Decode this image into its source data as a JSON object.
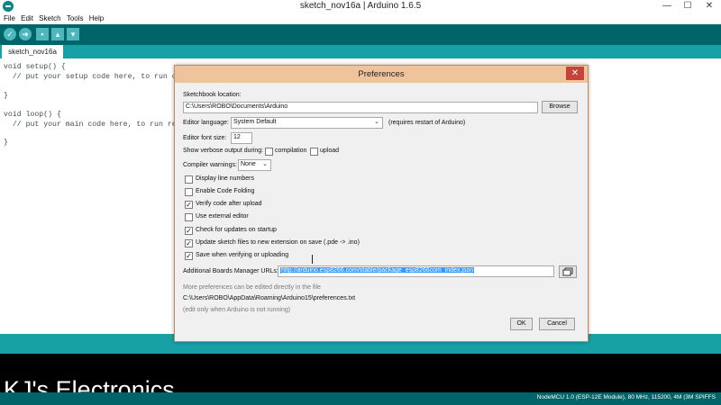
{
  "window": {
    "title": "sketch_nov16a | Arduino 1.6.5",
    "minimize": "—",
    "maximize": "☐",
    "close": "✕"
  },
  "menu": [
    "File",
    "Edit",
    "Sketch",
    "Tools",
    "Help"
  ],
  "toolbar": {
    "verify": "✓",
    "upload": "➜",
    "new": "▪",
    "open": "▴",
    "save": "▾"
  },
  "tab": {
    "label": "sketch_nov16a"
  },
  "code": [
    "void setup() {",
    "  // put your setup code here, to run once:",
    "",
    "}",
    "",
    "void loop() {",
    "  // put your main code here, to run repeat",
    "",
    "}"
  ],
  "watermark": "KJ's Electronics",
  "status": {
    "board": "NodeMCU 1.0 (ESP-12E Module), 80 MHz, 115200, 4M (3M SPIFFS"
  },
  "dialog": {
    "title": "Preferences",
    "close": "✕",
    "sketchbook_label": "Sketchbook location:",
    "sketchbook_value": "C:\\Users\\ROBO\\Documents\\Arduino",
    "browse": "Browse",
    "language_label": "Editor language:",
    "language_value": "System Default",
    "language_note": "(requires restart of Arduino)",
    "fontsize_label": "Editor font size:",
    "fontsize_value": "12",
    "verbose_label": "Show verbose output during:",
    "verbose_compilation": "compilation",
    "verbose_upload": "upload",
    "warnings_label": "Compiler warnings:",
    "warnings_value": "None",
    "options": [
      {
        "label": "Display line numbers",
        "checked": false
      },
      {
        "label": "Enable Code Folding",
        "checked": false
      },
      {
        "label": "Verify code after upload",
        "checked": true
      },
      {
        "label": "Use external editor",
        "checked": false
      },
      {
        "label": "Check for updates on startup",
        "checked": true
      },
      {
        "label": "Update sketch files to new extension on save (.pde -> .ino)",
        "checked": true
      },
      {
        "label": "Save when verifying or uploading",
        "checked": true
      }
    ],
    "boards_label": "Additional Boards Manager URLs:",
    "boards_value": "http://arduino.esp8266.com/stable/package_esp8266com_index.json",
    "more_prefs": "More preferences can be edited directly in the file",
    "prefs_path": "C:\\Users\\ROBO\\AppData\\Roaming\\Arduino15\\preferences.txt",
    "edit_note": "(edit only when Arduino is not running)",
    "ok": "OK",
    "cancel": "Cancel"
  }
}
